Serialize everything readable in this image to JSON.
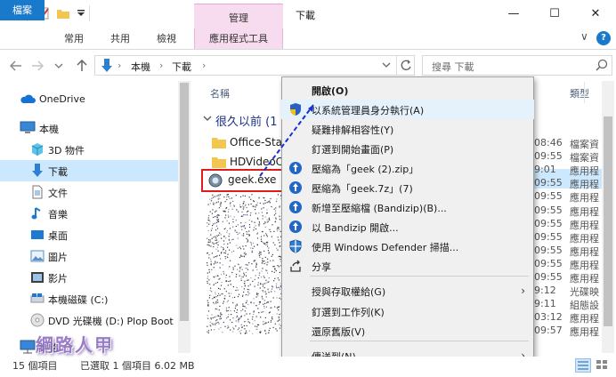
{
  "window": {
    "title": "下載",
    "context_group_label": "管理",
    "controls": {
      "minimize": "—",
      "maximize": "☐",
      "close": "✕"
    }
  },
  "ribbon": {
    "tabs": [
      "檔案",
      "常用",
      "共用",
      "檢視",
      "應用程式工具"
    ],
    "collapse_glyph": "∨",
    "help_glyph": "?"
  },
  "address": {
    "crumbs": [
      "本機",
      "下載"
    ],
    "separator": "›",
    "search_placeholder": "搜尋 下載"
  },
  "nav": {
    "items": [
      {
        "label": "OneDrive",
        "icon": "onedrive-cloud-icon"
      },
      {
        "label": "本機",
        "icon": "computer-icon"
      },
      {
        "label": "3D 物件",
        "icon": "3d-objects-icon"
      },
      {
        "label": "下載",
        "icon": "download-icon",
        "selected": true
      },
      {
        "label": "文件",
        "icon": "documents-icon"
      },
      {
        "label": "音樂",
        "icon": "music-icon"
      },
      {
        "label": "桌面",
        "icon": "desktop-icon"
      },
      {
        "label": "圖片",
        "icon": "pictures-icon"
      },
      {
        "label": "影片",
        "icon": "videos-icon"
      },
      {
        "label": "本機磁碟 (C:)",
        "icon": "local-disk-icon"
      },
      {
        "label": "DVD 光碟機 (D:) Plop Boot",
        "icon": "dvd-drive-icon"
      },
      {
        "label": "網路",
        "icon": "network-icon"
      }
    ]
  },
  "files": {
    "columns": {
      "name": "名稱",
      "type": "類型"
    },
    "group_label": "很久以前 (1",
    "rows": [
      {
        "name": "Office-Sta",
        "icon": "folder-icon"
      },
      {
        "name": "HDVideoC",
        "icon": "folder-icon"
      },
      {
        "name": "geek.exe",
        "icon": "geek-app-icon",
        "selected": true
      }
    ],
    "right_times": [
      "08:46",
      "09:55",
      "9:01",
      "09:55",
      "09:55",
      "09:55",
      "09:55",
      "09:55",
      "09:55",
      "09:55",
      "09:55",
      "9:12",
      "9:11",
      "03:12",
      "09:57"
    ],
    "right_types": [
      "檔案資",
      "檔案資",
      "應用程",
      "應用程",
      "應用程",
      "應用程",
      "應用程",
      "應用程",
      "應用程",
      "應用程",
      "應用程",
      "光碟映",
      "組態設",
      "應用程",
      "應用程"
    ]
  },
  "context_menu": {
    "items": [
      {
        "label": "開啟(O)",
        "bold": true,
        "icon": ""
      },
      {
        "label": "以系統管理員身分執行(A)",
        "icon": "uac-shield-icon",
        "hover": true
      },
      {
        "label": "疑難排解相容性(Y)",
        "icon": ""
      },
      {
        "label": "釘選到開始畫面(P)",
        "icon": ""
      },
      {
        "label": "壓縮為「geek (2).zip」",
        "icon": "bandizip-icon"
      },
      {
        "label": "壓縮為「geek.7z」(7)",
        "icon": "bandizip-icon"
      },
      {
        "label": "新增至壓縮檔 (Bandizip)(B)...",
        "icon": "bandizip-icon"
      },
      {
        "label": "以 Bandizip 開啟...",
        "icon": "bandizip-icon"
      },
      {
        "label": "使用 Windows Defender 掃描...",
        "icon": "defender-icon"
      },
      {
        "label": "分享",
        "icon": "share-icon"
      },
      {
        "label": "授與存取權給(G)",
        "icon": "",
        "submenu": true
      },
      {
        "label": "釘選到工作列(K)",
        "icon": ""
      },
      {
        "label": "還原舊版(V)",
        "icon": ""
      },
      {
        "label": "傳送到(N)",
        "icon": "",
        "submenu": true
      }
    ],
    "submenu_glyph": "›"
  },
  "status": {
    "item_count": "15 個項目",
    "selection": "已選取 1 個項目  6.02 MB"
  },
  "watermark": "綱路人甲",
  "colors": {
    "accent": "#1979ca",
    "selection": "#cce8ff",
    "app_tools": "#f7dcef",
    "highlight_box": "#e01b1b",
    "pointer_line": "#1b2fd0"
  }
}
